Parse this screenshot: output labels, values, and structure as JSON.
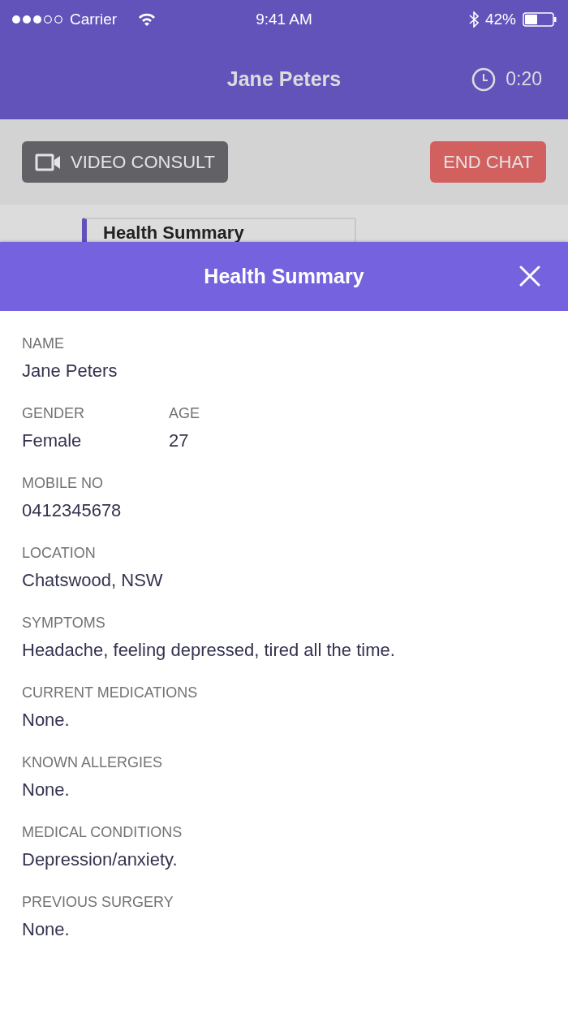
{
  "status_bar": {
    "carrier": "Carrier",
    "time": "9:41 AM",
    "battery": "42%"
  },
  "header": {
    "title": "Jane Peters",
    "timer": "0:20"
  },
  "actions": [
    {
      "kind": "video",
      "label": "VIDEO CONSULT"
    },
    {
      "kind": "end",
      "label": "END CHAT"
    }
  ],
  "chat_card": {
    "title": "Health Summary"
  },
  "sheet": {
    "title": "Health Summary",
    "rows": [
      {
        "fields": [
          {
            "label": "NAME",
            "value": "Jane Peters"
          }
        ]
      },
      {
        "fields": [
          {
            "label": "GENDER",
            "value": "Female"
          },
          {
            "label": "AGE",
            "value": "27"
          }
        ]
      },
      {
        "fields": [
          {
            "label": "MOBILE NO",
            "value": "0412345678"
          }
        ]
      },
      {
        "fields": [
          {
            "label": "LOCATION",
            "value": "Chatswood, NSW"
          }
        ]
      },
      {
        "fields": [
          {
            "label": "SYMPTOMS",
            "value": "Headache, feeling depressed, tired all the time."
          }
        ]
      },
      {
        "fields": [
          {
            "label": "CURRENT MEDICATIONS",
            "value": "None."
          }
        ]
      },
      {
        "fields": [
          {
            "label": "KNOWN ALLERGIES",
            "value": "None."
          }
        ]
      },
      {
        "fields": [
          {
            "label": "MEDICAL CONDITIONS",
            "value": "Depression/anxiety."
          }
        ]
      },
      {
        "fields": [
          {
            "label": "PREVIOUS SURGERY",
            "value": "None."
          }
        ]
      }
    ]
  }
}
